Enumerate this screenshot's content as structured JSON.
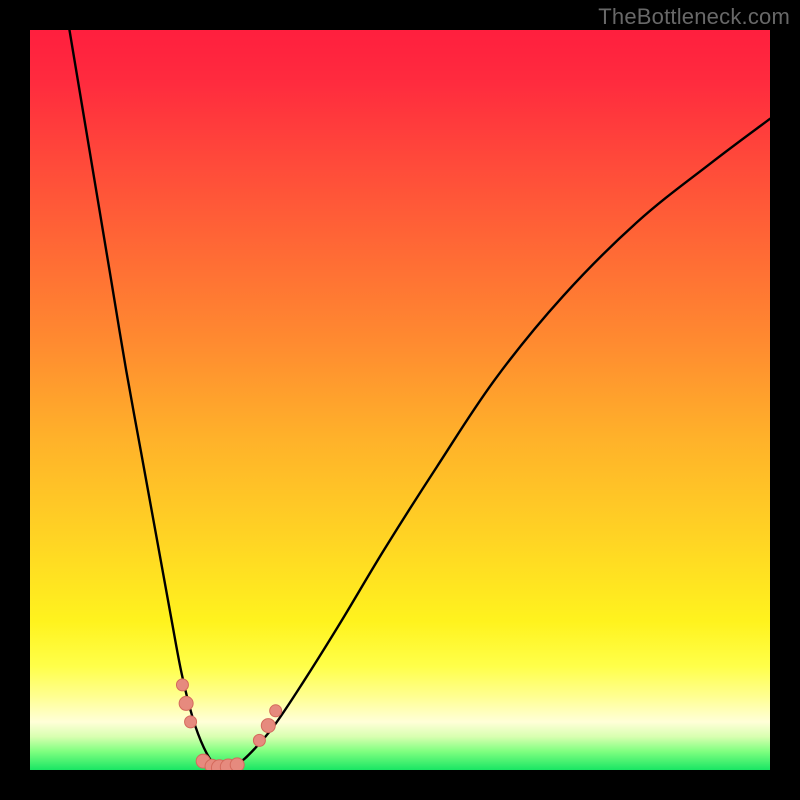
{
  "watermark": "TheBottleneck.com",
  "colors": {
    "black": "#000000",
    "curve": "#000000",
    "marker_fill": "#e68a7e",
    "marker_stroke": "#d46a5c"
  },
  "gradient_stops": [
    {
      "offset": 0.0,
      "color": "#ff1f3e"
    },
    {
      "offset": 0.07,
      "color": "#ff2b3e"
    },
    {
      "offset": 0.18,
      "color": "#ff4a3a"
    },
    {
      "offset": 0.3,
      "color": "#ff6a35"
    },
    {
      "offset": 0.42,
      "color": "#ff8a30"
    },
    {
      "offset": 0.55,
      "color": "#ffb12a"
    },
    {
      "offset": 0.68,
      "color": "#ffd224"
    },
    {
      "offset": 0.8,
      "color": "#fff31e"
    },
    {
      "offset": 0.86,
      "color": "#ffff4a"
    },
    {
      "offset": 0.9,
      "color": "#ffff90"
    },
    {
      "offset": 0.935,
      "color": "#ffffd8"
    },
    {
      "offset": 0.955,
      "color": "#d8ffb0"
    },
    {
      "offset": 0.975,
      "color": "#7fff80"
    },
    {
      "offset": 1.0,
      "color": "#19e664"
    }
  ],
  "chart_data": {
    "type": "line",
    "title": "",
    "xlabel": "",
    "ylabel": "",
    "xlim": [
      0,
      100
    ],
    "ylim": [
      0,
      100
    ],
    "series": [
      {
        "name": "bottleneck-curve",
        "x": [
          5,
          7,
          9,
          11,
          13,
          15,
          17,
          19,
          20.5,
          22,
          23.5,
          25,
          26,
          27,
          28,
          30,
          33,
          37,
          42,
          48,
          55,
          63,
          72,
          82,
          92,
          100
        ],
        "y": [
          102,
          90,
          78,
          66,
          54,
          43,
          32,
          21,
          13,
          7,
          3,
          0.6,
          0.3,
          0.3,
          0.7,
          2.5,
          6,
          12,
          20,
          30,
          41,
          53,
          64,
          74,
          82,
          88
        ]
      }
    ],
    "markers": [
      {
        "x": 20.6,
        "y": 11.5,
        "r": 6
      },
      {
        "x": 21.1,
        "y": 9.0,
        "r": 7
      },
      {
        "x": 21.7,
        "y": 6.5,
        "r": 6
      },
      {
        "x": 23.4,
        "y": 1.2,
        "r": 7
      },
      {
        "x": 24.6,
        "y": 0.5,
        "r": 7
      },
      {
        "x": 25.6,
        "y": 0.3,
        "r": 8
      },
      {
        "x": 26.8,
        "y": 0.4,
        "r": 8
      },
      {
        "x": 28.0,
        "y": 0.7,
        "r": 7
      },
      {
        "x": 31.0,
        "y": 4.0,
        "r": 6
      },
      {
        "x": 32.2,
        "y": 6.0,
        "r": 7
      },
      {
        "x": 33.2,
        "y": 8.0,
        "r": 6
      }
    ],
    "grid": false,
    "legend": false
  }
}
